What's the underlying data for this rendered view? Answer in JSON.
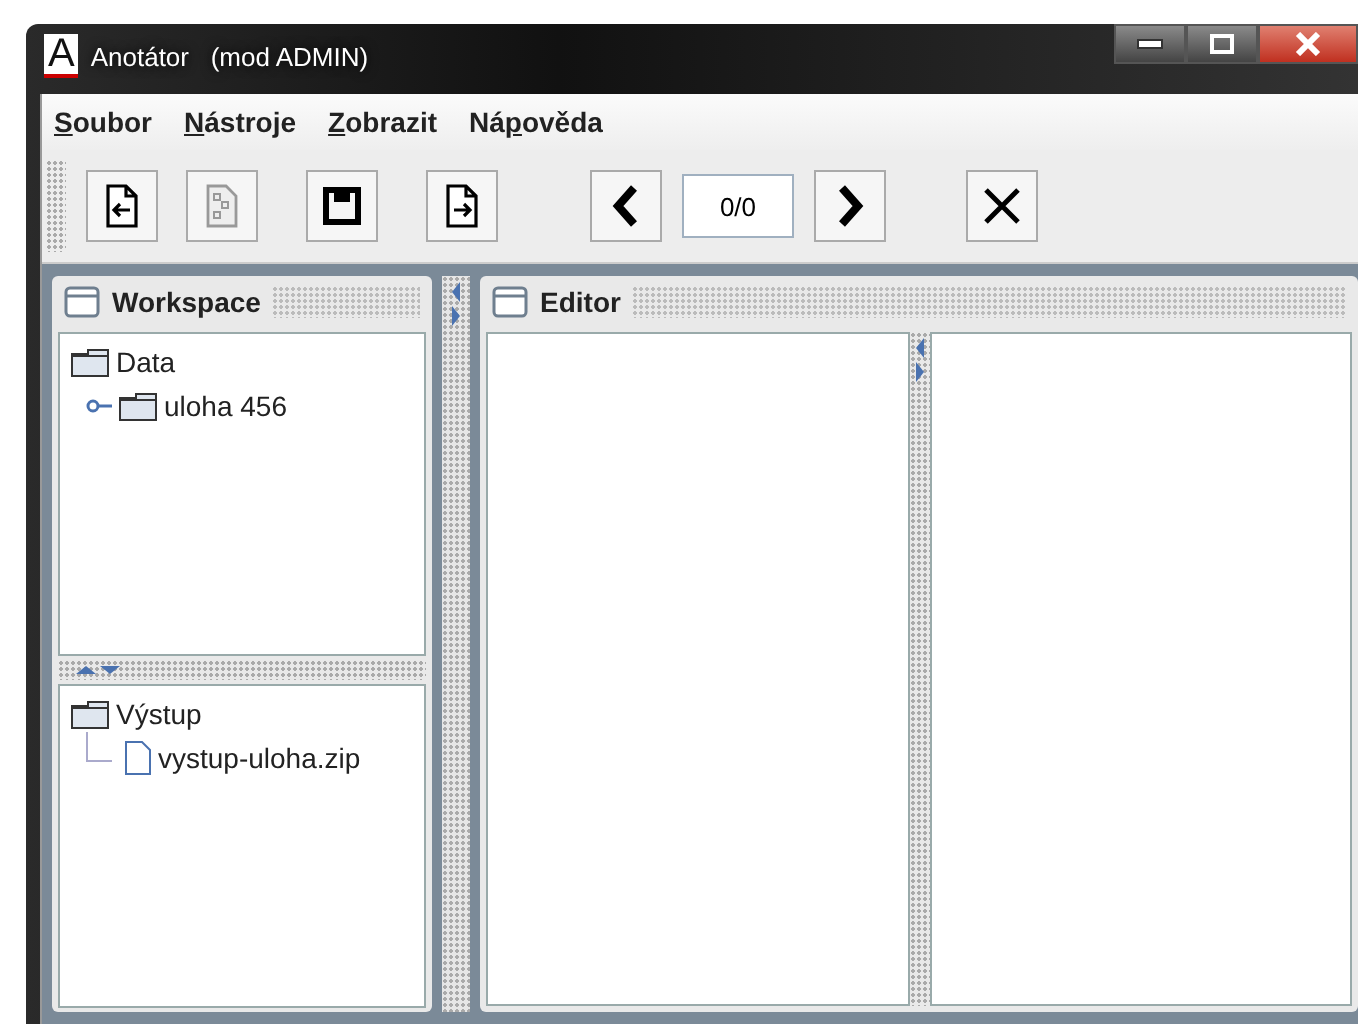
{
  "window": {
    "logo": "A",
    "title": "Anotátor   (mod ADMIN)"
  },
  "menu": [
    {
      "parts": [
        {
          "text": "S",
          "underlined": true
        },
        {
          "text": "oubor",
          "underlined": false
        }
      ]
    },
    {
      "parts": [
        {
          "text": "N",
          "underlined": true
        },
        {
          "text": "ástroje",
          "underlined": false
        }
      ]
    },
    {
      "parts": [
        {
          "text": "Z",
          "underlined": true
        },
        {
          "text": "obrazit",
          "underlined": false
        }
      ]
    },
    {
      "parts": [
        {
          "text": "Ná",
          "underlined": false
        },
        {
          "text": "p",
          "underlined": true
        },
        {
          "text": "ověda",
          "underlined": false
        }
      ]
    }
  ],
  "toolbar": [
    {
      "kind": "open"
    },
    {
      "kind": "structure"
    },
    {
      "kind": "save"
    },
    {
      "kind": "export"
    },
    {
      "kind": "prev"
    },
    {
      "kind": "counter",
      "text": "0/0"
    },
    {
      "kind": "next"
    },
    {
      "kind": "close"
    }
  ],
  "workspace": {
    "title": "Workspace",
    "trees": [
      {
        "label": "Data",
        "kind": "folder",
        "children": [
          {
            "label": "uloha 456",
            "kind": "folder"
          }
        ]
      },
      {
        "label": "Výstup",
        "kind": "folder",
        "children": [
          {
            "label": "vystup-uloha.zip",
            "kind": "file"
          }
        ]
      }
    ]
  },
  "editor": {
    "title": "Editor"
  }
}
